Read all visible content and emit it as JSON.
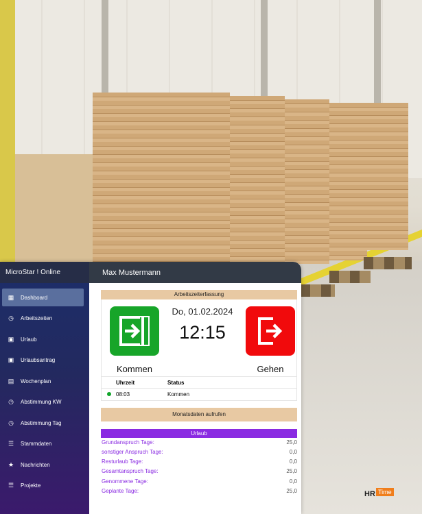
{
  "app": {
    "brand": "MicroStar ! Online"
  },
  "user": {
    "name": "Max Mustermann"
  },
  "sidebar": {
    "items": [
      {
        "label": "Dashboard",
        "icon": "grid-icon"
      },
      {
        "label": "Arbeitszeiten",
        "icon": "clock-icon"
      },
      {
        "label": "Urlaub",
        "icon": "calendar-icon"
      },
      {
        "label": "Urlaubsantrag",
        "icon": "calendar-icon"
      },
      {
        "label": "Wochenplan",
        "icon": "calendar-check-icon"
      },
      {
        "label": "Abstimmung KW",
        "icon": "clock-icon"
      },
      {
        "label": "Abstimmung Tag",
        "icon": "clock-icon"
      },
      {
        "label": "Stammdaten",
        "icon": "list-icon"
      },
      {
        "label": "Nachrichten",
        "icon": "star-icon"
      },
      {
        "label": "Projekte",
        "icon": "list-icon"
      }
    ],
    "active_index": 0
  },
  "zeiterfassung": {
    "title": "Arbeitszeiterfassung",
    "date": "Do, 01.02.2024",
    "time": "12:15",
    "kommen_label": "Kommen",
    "gehen_label": "Gehen"
  },
  "log": {
    "headers": {
      "time": "Uhrzeit",
      "status": "Status"
    },
    "rows": [
      {
        "time": "08:03",
        "status": "Kommen"
      }
    ]
  },
  "monatsdaten_button": "Monatsdaten aufrufen",
  "urlaub": {
    "title": "Urlaub",
    "rows": [
      {
        "label": "Grundanspruch Tage:",
        "value": "25,0"
      },
      {
        "label": "sonstiger Anspruch Tage:",
        "value": "0,0"
      },
      {
        "label": "Resturlaub Tage:",
        "value": "0,0"
      },
      {
        "label": "Gesamtanspruch Tage:",
        "value": "25,0"
      },
      {
        "label": "Genommene Tage:",
        "value": "0,0"
      },
      {
        "label": "Geplante Tage:",
        "value": "25,0"
      }
    ]
  },
  "logo": {
    "hr": "HR",
    "time": "Time"
  },
  "colors": {
    "kommen": "#17a529",
    "gehen": "#f10a0c",
    "urlaub_accent": "#8a2be2",
    "section": "#e8c9a3"
  }
}
